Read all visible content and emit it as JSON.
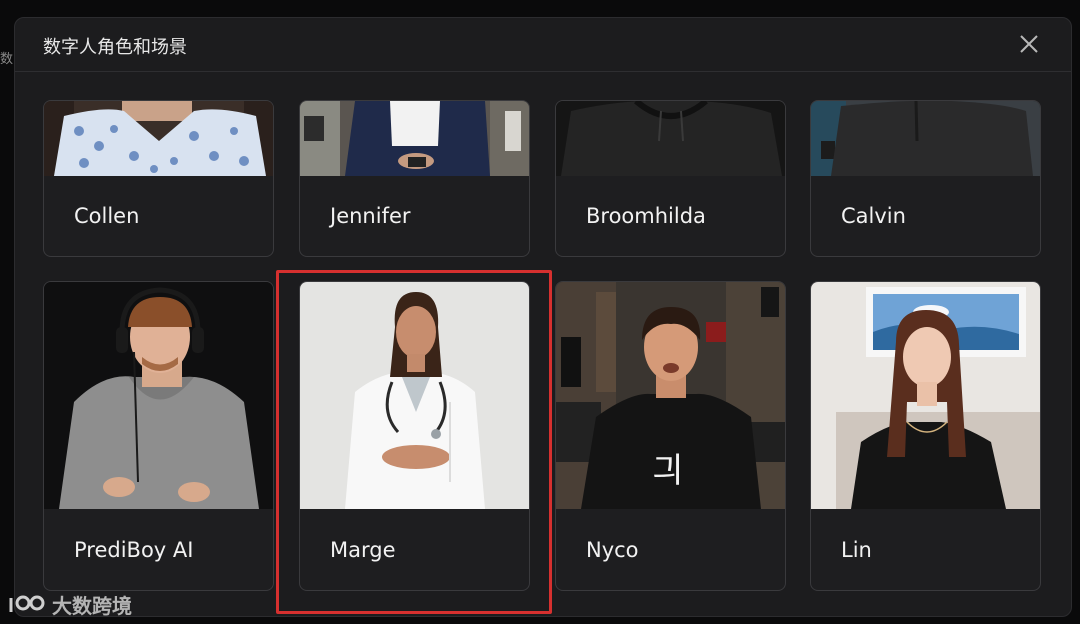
{
  "background": {
    "fragment": "数"
  },
  "dialog": {
    "title": "数字人角色和场景",
    "close_icon": "close-icon"
  },
  "avatars": [
    {
      "name": "Collen"
    },
    {
      "name": "Jennifer"
    },
    {
      "name": "Broomhilda"
    },
    {
      "name": "Calvin"
    },
    {
      "name": "PrediBoy AI"
    },
    {
      "name": "Marge",
      "highlighted": true
    },
    {
      "name": "Nyco"
    },
    {
      "name": "Lin"
    }
  ],
  "highlight_color": "#d6302f",
  "watermark": {
    "text": "大数跨境"
  }
}
